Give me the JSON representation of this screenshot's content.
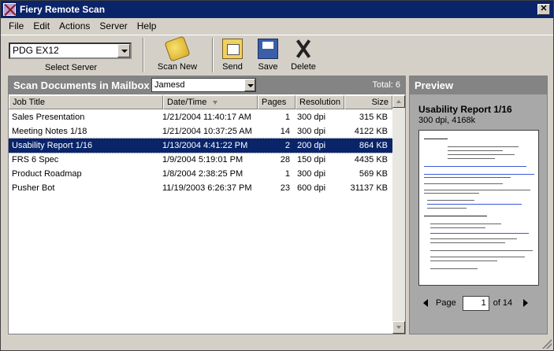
{
  "window": {
    "title": "Fiery Remote Scan",
    "close_glyph": "✕"
  },
  "menu": [
    "File",
    "Edit",
    "Actions",
    "Server",
    "Help"
  ],
  "toolbar": {
    "server_value": "PDG EX12",
    "select_server_label": "Select Server",
    "scan_new_label": "Scan New",
    "send_label": "Send",
    "save_label": "Save",
    "delete_label": "Delete"
  },
  "documents_pane": {
    "title": "Scan Documents in Mailbox",
    "mailbox_value": "Jamesd",
    "total_label": "Total: 6",
    "columns": [
      "Job Title",
      "Date/Time",
      "Pages",
      "Resolution",
      "Size"
    ],
    "rows": [
      {
        "title": "Sales Presentation",
        "date": "1/21/2004 11:40:17 AM",
        "pages": "1",
        "res": "300 dpi",
        "size": "315 KB"
      },
      {
        "title": "Meeting Notes 1/18",
        "date": "1/21/2004 10:37:25 AM",
        "pages": "14",
        "res": "300 dpi",
        "size": "4122 KB"
      },
      {
        "title": "Usability Report 1/16",
        "date": "1/13/2004 4:41:22 PM",
        "pages": "2",
        "res": "200 dpi",
        "size": "864 KB"
      },
      {
        "title": "FRS 6 Spec",
        "date": "1/9/2004 5:19:01 PM",
        "pages": "28",
        "res": "150 dpi",
        "size": "4435 KB"
      },
      {
        "title": "Product Roadmap",
        "date": "1/8/2004 2:38:25 PM",
        "pages": "1",
        "res": "300 dpi",
        "size": "569 KB"
      },
      {
        "title": "Pusher Bot",
        "date": "11/19/2003 6:26:37 PM",
        "pages": "23",
        "res": "600 dpi",
        "size": "31137 KB"
      }
    ]
  },
  "preview_pane": {
    "title": "Preview",
    "doc_title": "Usability Report 1/16",
    "doc_info": "300 dpi, 4168k",
    "page_label": "Page",
    "page_value": "1",
    "page_of": "of 14"
  }
}
